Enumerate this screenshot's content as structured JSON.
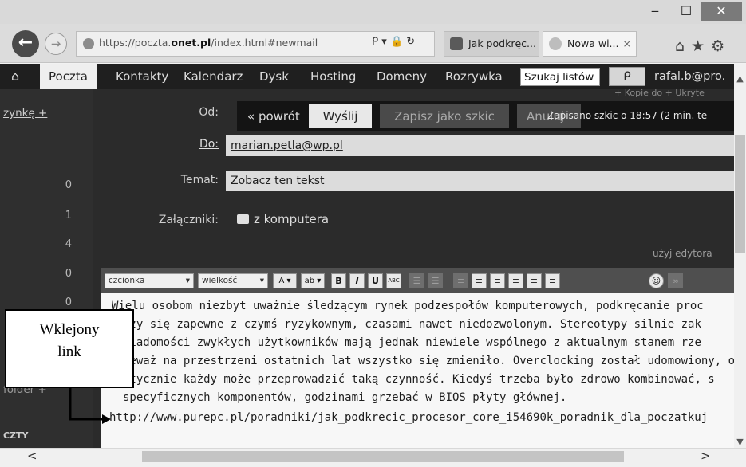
{
  "window": {
    "minimize_glyph": "‒",
    "maximize_glyph": "☐",
    "close_glyph": "✕"
  },
  "nav": {
    "back_glyph": "←",
    "forward_glyph": "→",
    "url_prefix": "https://poczta.",
    "url_domain": "onet.pl",
    "url_suffix": "/index.html#newmail",
    "address_tools": "ᑭ ▾ 🔒 ↻",
    "tabs": [
      {
        "label": "Jak podkręc..."
      },
      {
        "label": "Nowa wi...",
        "close": "×"
      }
    ],
    "right_icons": "⌂★⚙"
  },
  "menu": {
    "home_glyph": "⌂",
    "items": [
      "Poczta",
      "Kontakty",
      "Kalendarz",
      "Dysk",
      "Hosting",
      "Domeny",
      "Rozrywka"
    ],
    "search_placeholder": "Szukaj listów",
    "search_button": "ᑭ",
    "user": "rafal.b@pro."
  },
  "sidebar": {
    "new_label": "zynkę +",
    "counts": [
      "0",
      "1",
      "4",
      "0",
      "0"
    ],
    "folder_label": "folder +",
    "section_label": "CZTY"
  },
  "compose": {
    "top_links": "+ Kopie do   + Ukryte",
    "from_label": "Od:",
    "to_label": "Do:",
    "subject_label": "Temat:",
    "attachments_label": "Załączniki:",
    "back_link": "« powrót",
    "send_label": "Wyślij",
    "save_draft_label": "Zapisz jako szkic",
    "cancel_label": "Anuluj",
    "saved_note": "Zapisano szkic o 18:57 (2 min. te",
    "to_value": "marian.petla@wp.pl",
    "subject_value": "Zobacz ten tekst",
    "attach_link": "z komputera",
    "use_editor": "użyj edytora"
  },
  "toolbar": {
    "font_select": "czcionka",
    "size_select": "wielkość",
    "font_color": "A ▾",
    "highlight": "ab ▾",
    "bold": "B",
    "italic": "I",
    "underline": "U",
    "strike": "ABC"
  },
  "editor": {
    "lines": [
      "Wielu osobom niezbyt uważnie śledzącym rynek podzespołów komputerowych, podkręcanie proc",
      "rzy się zapewne z czymś ryzykownym, czasami nawet niedozwolonym. Stereotypy silnie zak",
      "wiadomości zwykłych użytkowników mają jednak niewiele wspólnego z aktualnym stanem rze",
      "ieważ na przestrzeni ostatnich lat wszystko się zmieniło. Overclocking został udomowiony, ol",
      "ktycznie każdy może przeprowadzić taką czynność. Kiedyś trzeba było zdrowo kombinować, s",
      "specyficznych komponentów, godzinami grzebać w BIOS płyty głównej."
    ],
    "link": "http://www.purepc.pl/poradniki/jak_podkrecic_procesor_core_i54690k_poradnik_dla_poczatkuj"
  },
  "annotation": {
    "line1": "Wklejony",
    "line2": "link"
  },
  "scroll": {
    "up": "▲",
    "down": "▼",
    "left": "<",
    "right": ">"
  }
}
